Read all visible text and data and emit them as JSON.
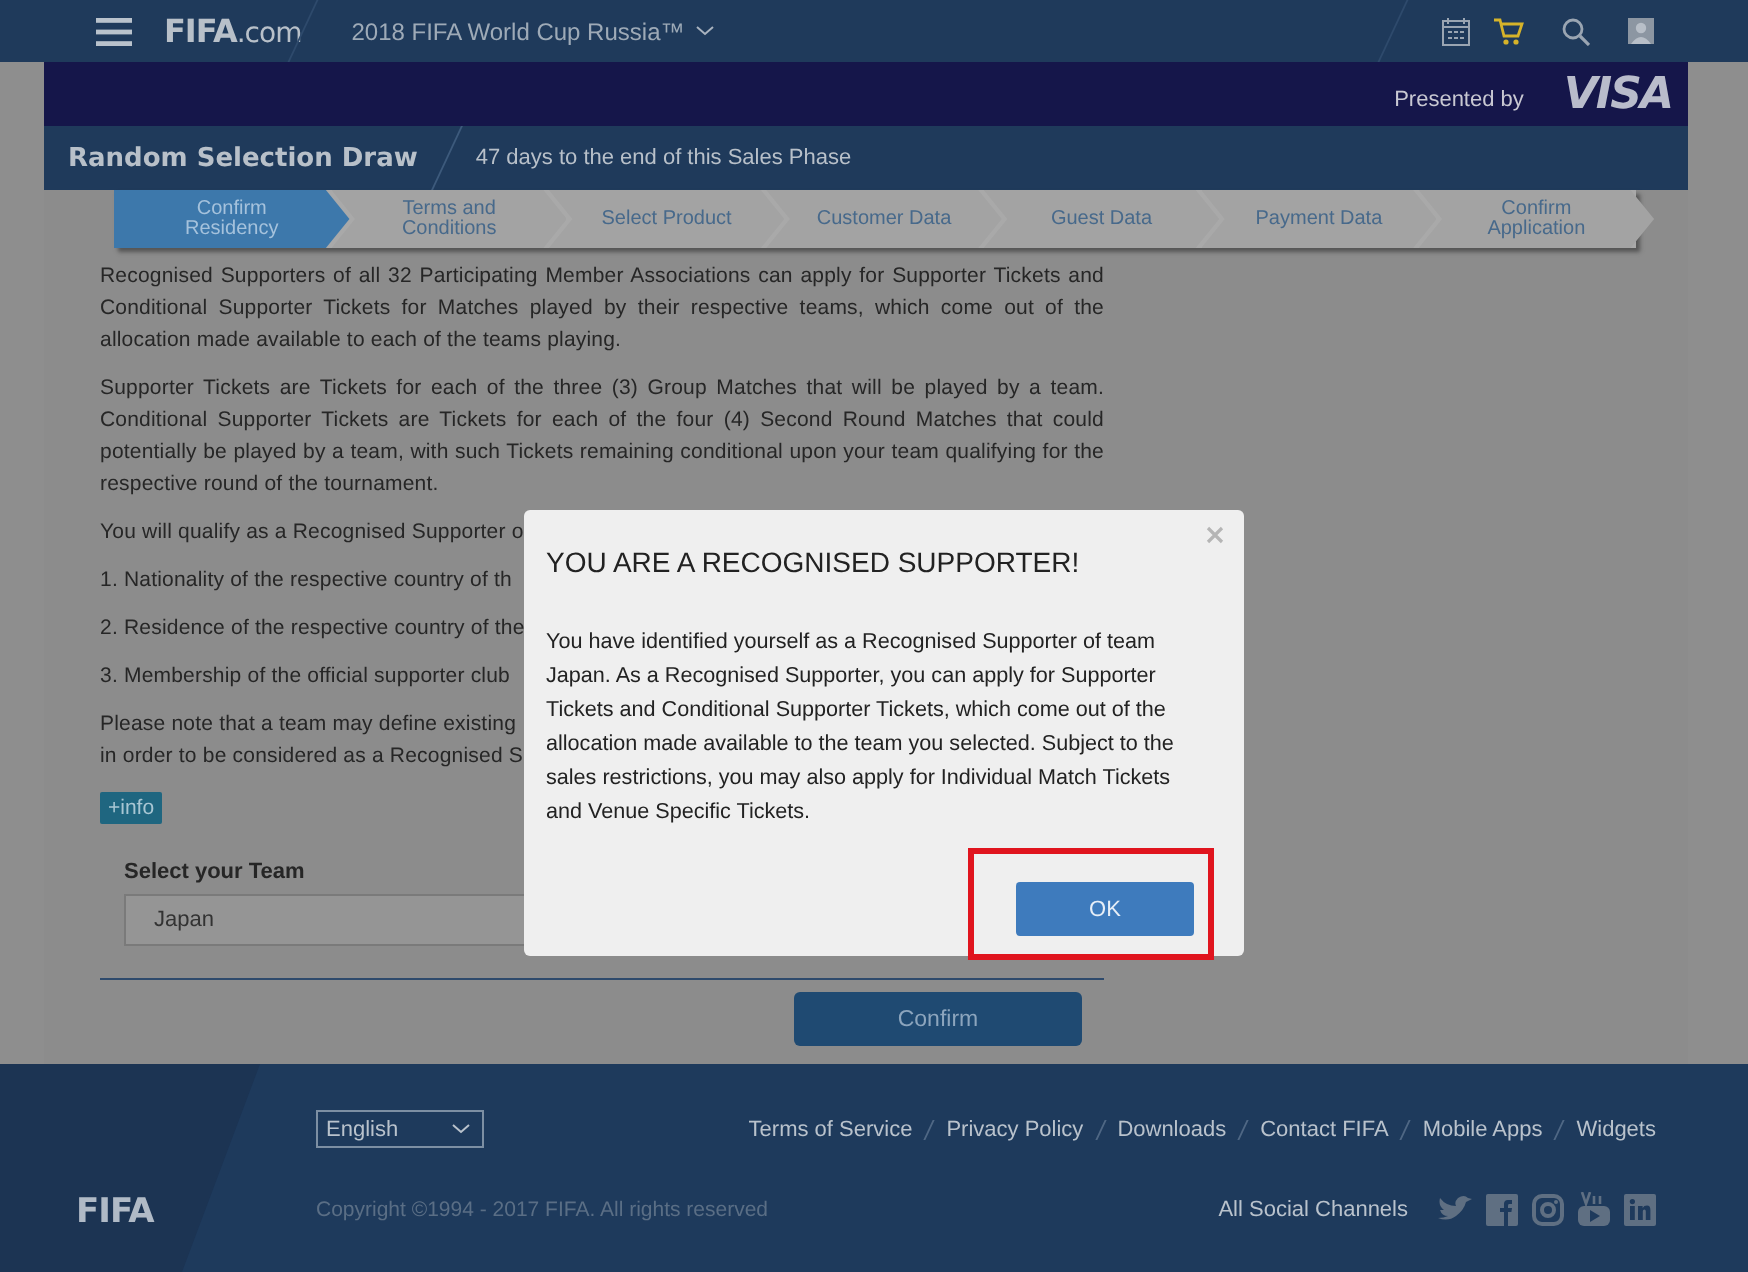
{
  "header": {
    "logo": "FIFA",
    "logo_suffix": ".com",
    "event": "2018 FIFA World Cup Russia™"
  },
  "sponsor": {
    "label": "Presented by",
    "brand": "VISA"
  },
  "sales_bar": {
    "title": "Random Selection Draw",
    "message": "47 days to the end of this Sales Phase"
  },
  "steps": [
    {
      "label": "Confirm Residency",
      "selected": true
    },
    {
      "label": "Terms and Conditions",
      "selected": false
    },
    {
      "label": "Select Product",
      "selected": false
    },
    {
      "label": "Customer Data",
      "selected": false
    },
    {
      "label": "Guest Data",
      "selected": false
    },
    {
      "label": "Payment Data",
      "selected": false
    },
    {
      "label": "Confirm Application",
      "selected": false
    }
  ],
  "content": {
    "blocks": [
      {
        "kind": "paragraph",
        "text": "Recognised Supporters of all 32 Participating Member Associations can apply for Supporter Tickets and Conditional Supporter Tickets for Matches played by their respective teams, which come out of the allocation made available to each of the teams playing."
      },
      {
        "kind": "paragraph",
        "text": "Supporter Tickets are Tickets for each of the three (3) Group Matches that will be played by a team. Conditional Supporter Tickets are Tickets for each of the four (4) Second Round Matches that could potentially be played by a team, with such Tickets remaining conditional upon your team qualifying for the respective round of the tournament."
      },
      {
        "kind": "paragraph",
        "text": "You will qualify as a Recognised Supporter o"
      },
      {
        "kind": "paragraph",
        "text": "1. Nationality of the respective country of th"
      },
      {
        "kind": "paragraph",
        "text": "2. Residence of the respective country of the"
      },
      {
        "kind": "paragraph",
        "text": "3. Membership of the official supporter club"
      },
      {
        "kind": "line",
        "text": "Please note that a team may define existing"
      },
      {
        "kind": "paragraph",
        "text": "in order to be considered as a Recognised S"
      }
    ],
    "info_button": "+info",
    "team_field": {
      "label": "Select your Team",
      "value": "Japan"
    },
    "confirm_button": "Confirm"
  },
  "dialog": {
    "title": "YOU ARE A RECOGNISED SUPPORTER!",
    "body": "You have identified yourself as a Recognised Supporter of team Japan. As a Recognised Supporter, you can apply for Supporter Tickets and Conditional Supporter Tickets, which come out of the allocation made available to the team you selected. Subject to the sales restrictions, you may also apply for Individual Match Tickets and Venue Specific Tickets.",
    "ok_button": "OK",
    "ok_highlighted": true
  },
  "footer": {
    "language": "English",
    "links": [
      "Terms of Service",
      "Privacy Policy",
      "Downloads",
      "Contact FIFA",
      "Mobile Apps",
      "Widgets"
    ],
    "copyright": "Copyright ©1994 - 2017 FIFA. All rights reserved",
    "social_label": "All Social Channels",
    "logo": "FIFA"
  }
}
